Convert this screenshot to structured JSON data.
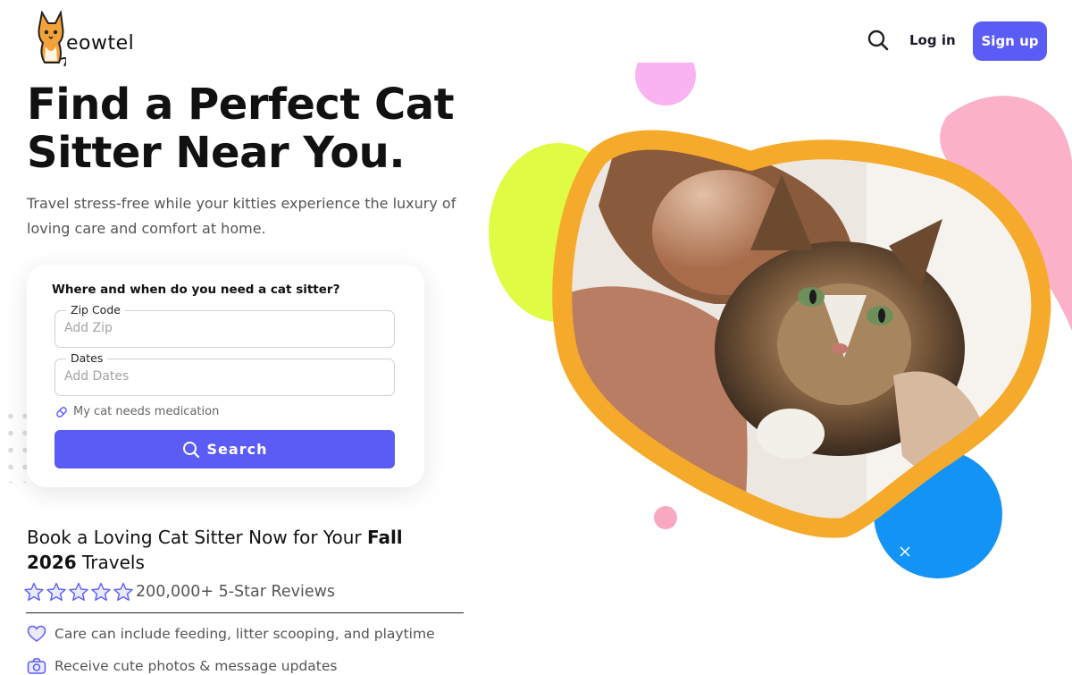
{
  "brand": {
    "name": "eowtel"
  },
  "nav": {
    "login_label": "Log in",
    "signup_label": "Sign up"
  },
  "hero": {
    "title_line1": "Find a Perfect Cat",
    "title_line2": "Sitter Near You.",
    "subtitle": "Travel stress-free while your kitties experience the luxury of loving care and comfort at home."
  },
  "search_card": {
    "title": "Where and when do you need a cat sitter?",
    "zip": {
      "label": "Zip Code",
      "placeholder": "Add Zip",
      "value": ""
    },
    "dates": {
      "label": "Dates",
      "placeholder": "Add Dates",
      "value": ""
    },
    "medication_label": "My cat needs medication",
    "search_label": "Search"
  },
  "booking": {
    "text_before": "Book a Loving Cat Sitter Now for Your ",
    "highlight": "Fall 2026",
    "text_after": " Travels"
  },
  "reviews": {
    "rating": 5,
    "label": "200,000+ 5-Star Reviews"
  },
  "features": [
    {
      "icon": "heart-icon",
      "text": "Care can include feeding, litter scooping, and playtime"
    },
    {
      "icon": "camera-icon",
      "text": "Receive cute photos & message updates"
    }
  ],
  "colors": {
    "accent": "#5b5cf6",
    "frame": "#f5aa2b",
    "blob_lime": "#dffb43",
    "blob_pink": "#fbb1c8",
    "blob_blue": "#1493f7",
    "blob_lilac": "#f8b3f0"
  },
  "hero_image": {
    "alt": "Woman hugging a fluffy tabby cat"
  }
}
